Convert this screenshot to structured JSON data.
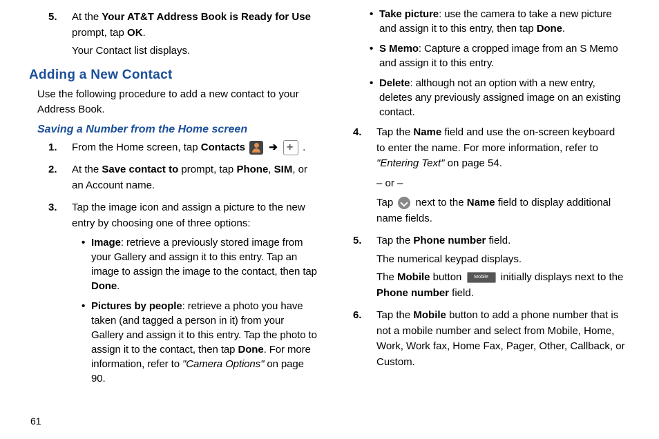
{
  "page_number": "61",
  "col1": {
    "step5_num": "5.",
    "step5_a": "At the ",
    "step5_b": "Your AT&T Address Book is Ready for Use",
    "step5_c": " prompt, tap ",
    "step5_d": "OK",
    "step5_e": ".",
    "step5_sub": "Your Contact list displays.",
    "h2": "Adding a New Contact",
    "intro": "Use the following procedure to add a new contact to your Address Book.",
    "h3": "Saving a Number from the Home screen",
    "s1_num": "1.",
    "s1_a": "From the Home screen, tap ",
    "s1_b": "Contacts",
    "s1_arrow": " ➔ ",
    "s1_period": " .",
    "s2_num": "2.",
    "s2_a": "At the ",
    "s2_b": "Save contact to",
    "s2_c": " prompt, tap ",
    "s2_d": "Phone",
    "s2_e": ", ",
    "s2_f": "SIM",
    "s2_g": ", or an Account name.",
    "s3_num": "3.",
    "s3_a": "Tap the image icon and assign a picture to the new entry by choosing one of three options:",
    "b1_a": "Image",
    "b1_b": ": retrieve a previously stored image from your Gallery and assign it to this entry. Tap an image to assign the image to the contact, then tap ",
    "b1_c": "Done",
    "b1_d": ".",
    "b2_a": "Pictures by people",
    "b2_b": ": retrieve a photo you have taken (and tagged a person in it) from your Gallery and assign it to this entry. Tap the photo to assign it to the contact, then tap ",
    "b2_c": "Done",
    "b2_d": ". For more information, refer to ",
    "b2_e": "\"Camera Options\"",
    "b2_f": "  on page 90."
  },
  "col2": {
    "b3_a": "Take picture",
    "b3_b": ": use the camera to take a new picture and assign it to this entry, then tap ",
    "b3_c": "Done",
    "b3_d": ".",
    "b4_a": "S Memo",
    "b4_b": ": Capture a cropped image from an S Memo and assign it to this entry.",
    "b5_a": "Delete",
    "b5_b": ": although not an option with a new entry, deletes any previously assigned image on an existing contact.",
    "s4_num": "4.",
    "s4_a": "Tap the ",
    "s4_b": "Name",
    "s4_c": " field and use the on-screen keyboard to enter the name. For more information, refer to ",
    "s4_d": "\"Entering Text\"",
    "s4_e": "  on page 54.",
    "s4_or": "– or –",
    "s4_f": "Tap ",
    "s4_g": " next to the ",
    "s4_h": "Name",
    "s4_i": " field to display additional name fields.",
    "s5_num": "5.",
    "s5_a": "Tap the ",
    "s5_b": "Phone number",
    "s5_c": " field.",
    "s5_sub1": "The numerical keypad displays.",
    "s5_d": "The ",
    "s5_e": "Mobile",
    "s5_f": " button ",
    "s5_g": " initially displays next to the ",
    "s5_h": "Phone number",
    "s5_i": " field.",
    "mobile_label": "Mobile",
    "s6_num": "6.",
    "s6_a": "Tap the ",
    "s6_b": "Mobile",
    "s6_c": " button to add a phone number that is not a mobile number and select from Mobile, Home, Work, Work fax, Home Fax, Pager, Other, Callback, or Custom."
  }
}
